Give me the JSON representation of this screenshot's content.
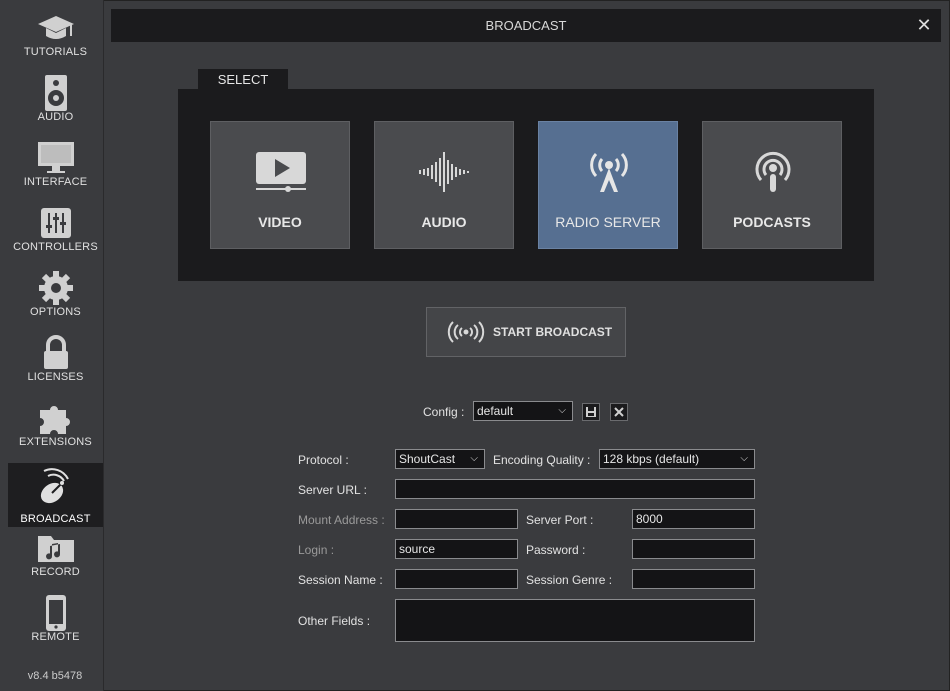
{
  "window": {
    "title": "BROADCAST"
  },
  "sidebar": {
    "items": [
      {
        "label": "TUTORIALS",
        "icon": "graduation-cap-icon"
      },
      {
        "label": "AUDIO",
        "icon": "speaker-icon"
      },
      {
        "label": "INTERFACE",
        "icon": "monitor-icon"
      },
      {
        "label": "CONTROLLERS",
        "icon": "sliders-icon"
      },
      {
        "label": "OPTIONS",
        "icon": "gear-icon"
      },
      {
        "label": "LICENSES",
        "icon": "lock-icon"
      },
      {
        "label": "EXTENSIONS",
        "icon": "puzzle-icon"
      },
      {
        "label": "BROADCAST",
        "icon": "satellite-dish-icon",
        "active": true
      },
      {
        "label": "RECORD",
        "icon": "music-folder-icon"
      },
      {
        "label": "REMOTE",
        "icon": "phone-icon"
      }
    ],
    "version": "v8.4 b5478"
  },
  "select": {
    "tab_label": "SELECT",
    "cards": [
      {
        "label": "VIDEO",
        "icon": "video-play-icon"
      },
      {
        "label": "AUDIO",
        "icon": "waveform-icon"
      },
      {
        "label": "RADIO SERVER",
        "icon": "radio-tower-icon",
        "selected": true
      },
      {
        "label": "PODCASTS",
        "icon": "podcast-icon"
      }
    ],
    "selected_color": "#566f91"
  },
  "start_broadcast": {
    "label": "START BROADCAST",
    "icon": "broadcast-waves-icon"
  },
  "config": {
    "label": "Config :",
    "value": "default",
    "save_icon": "floppy-icon",
    "delete_icon": "close-icon"
  },
  "form": {
    "protocol_label": "Protocol :",
    "protocol_value": "ShoutCast",
    "quality_label": "Encoding Quality :",
    "quality_value": "128 kbps (default)",
    "server_url_label": "Server URL :",
    "server_url_value": "",
    "mount_label": "Mount Address :",
    "mount_value": "",
    "port_label": "Server Port :",
    "port_value": "8000",
    "login_label": "Login :",
    "login_value": "source",
    "password_label": "Password :",
    "password_value": "",
    "session_name_label": "Session Name :",
    "session_name_value": "",
    "session_genre_label": "Session Genre :",
    "session_genre_value": "",
    "other_fields_label": "Other Fields :",
    "other_fields_value": ""
  }
}
